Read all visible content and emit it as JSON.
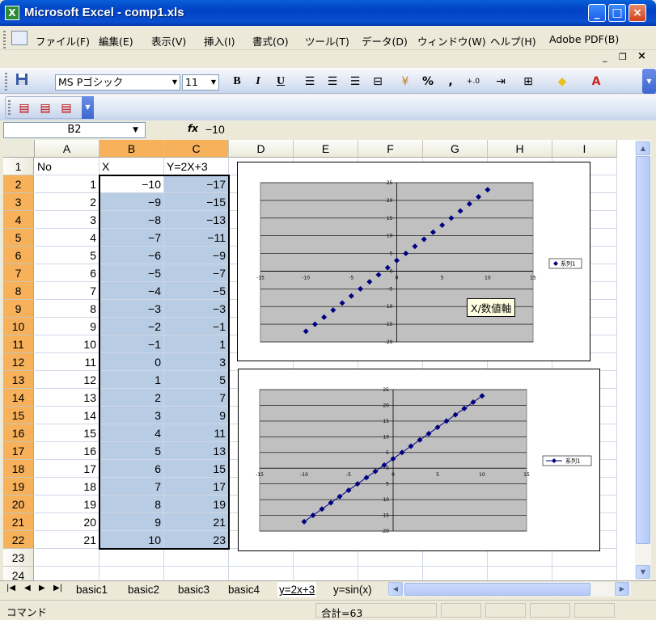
{
  "window": {
    "title": "Microsoft Excel - comp1.xls",
    "min_glyph": "_",
    "max_glyph": "□",
    "close_glyph": "×"
  },
  "menu": {
    "items": [
      "ファイル(F)",
      "編集(E)",
      "表示(V)",
      "挿入(I)",
      "書式(O)",
      "ツール(T)",
      "データ(D)",
      "ウィンドウ(W)",
      "ヘルプ(H)",
      "Adobe PDF(B)"
    ],
    "doc_min": "_",
    "doc_restore": "❐",
    "doc_close": "×"
  },
  "toolbar": {
    "font_name": "MS Pゴシック",
    "font_size": "11",
    "bold": "B",
    "italic": "I",
    "underline": "U",
    "percent": "%",
    "comma": ",",
    "decimal": "+.0"
  },
  "formula": {
    "name_box": "B2",
    "fx": "fx",
    "value": "−10"
  },
  "sheet": {
    "columns": [
      "A",
      "B",
      "C",
      "D",
      "E",
      "F",
      "G",
      "H",
      "I"
    ],
    "rows": [
      "1",
      "2",
      "3",
      "4",
      "5",
      "6",
      "7",
      "8",
      "9",
      "10",
      "11",
      "12",
      "13",
      "14",
      "15",
      "16",
      "17",
      "18",
      "19",
      "20",
      "21",
      "22",
      "23",
      "24"
    ],
    "header": [
      "No",
      "X",
      "Y=2X+3"
    ],
    "a_values": [
      "1",
      "2",
      "3",
      "4",
      "5",
      "6",
      "7",
      "8",
      "9",
      "10",
      "11",
      "12",
      "13",
      "14",
      "15",
      "16",
      "17",
      "18",
      "19",
      "20",
      "21"
    ],
    "b_values": [
      "−10",
      "−9",
      "−8",
      "−7",
      "−6",
      "−5",
      "−4",
      "−3",
      "−2",
      "−1",
      "0",
      "1",
      "2",
      "3",
      "4",
      "5",
      "6",
      "7",
      "8",
      "9",
      "10"
    ],
    "c_values": [
      "−17",
      "−15",
      "−13",
      "−11",
      "−9",
      "−7",
      "−5",
      "−3",
      "−1",
      "1",
      "3",
      "5",
      "7",
      "9",
      "11",
      "13",
      "15",
      "17",
      "19",
      "21",
      "23"
    ]
  },
  "tooltip": "X/数値軸",
  "chart_data": [
    {
      "type": "scatter",
      "x": [
        -10,
        -9,
        -8,
        -7,
        -6,
        -5,
        -4,
        -3,
        -2,
        -1,
        0,
        1,
        2,
        3,
        4,
        5,
        6,
        7,
        8,
        9,
        10
      ],
      "series": [
        {
          "name": "系列1",
          "values": [
            -17,
            -15,
            -13,
            -11,
            -9,
            -7,
            -5,
            -3,
            -1,
            1,
            3,
            5,
            7,
            9,
            11,
            13,
            15,
            17,
            19,
            21,
            23
          ]
        }
      ],
      "xlim": [
        -15,
        15
      ],
      "ylim": [
        -20,
        25
      ],
      "xticks": [
        "-15",
        "-10",
        "-5",
        "0",
        "5",
        "10",
        "15"
      ],
      "yticks": [
        "25",
        "20",
        "15",
        "10",
        "5",
        "0",
        "-5",
        "-10",
        "-15",
        "-20"
      ],
      "grid": true,
      "legend": "right",
      "marker_color": "#000080",
      "plot_bg": "#c0c0c0"
    },
    {
      "type": "line",
      "x": [
        -10,
        -9,
        -8,
        -7,
        -6,
        -5,
        -4,
        -3,
        -2,
        -1,
        0,
        1,
        2,
        3,
        4,
        5,
        6,
        7,
        8,
        9,
        10
      ],
      "series": [
        {
          "name": "系列1",
          "values": [
            -17,
            -15,
            -13,
            -11,
            -9,
            -7,
            -5,
            -3,
            -1,
            1,
            3,
            5,
            7,
            9,
            11,
            13,
            15,
            17,
            19,
            21,
            23
          ]
        }
      ],
      "xlim": [
        -15,
        15
      ],
      "ylim": [
        -20,
        25
      ],
      "xticks": [
        "-15",
        "-10",
        "-5",
        "0",
        "5",
        "10",
        "15"
      ],
      "yticks": [
        "25",
        "20",
        "15",
        "10",
        "5",
        "0",
        "-5",
        "-10",
        "-15",
        "-20"
      ],
      "grid": true,
      "legend": "right",
      "marker_color": "#000080",
      "plot_bg": "#c0c0c0"
    }
  ],
  "tabs": {
    "items": [
      "basic1",
      "basic2",
      "basic3",
      "basic4",
      "y=2x+3",
      "y=sin(x)"
    ],
    "active": 4
  },
  "status": {
    "mode": "コマンド",
    "sum": "合計=63"
  }
}
